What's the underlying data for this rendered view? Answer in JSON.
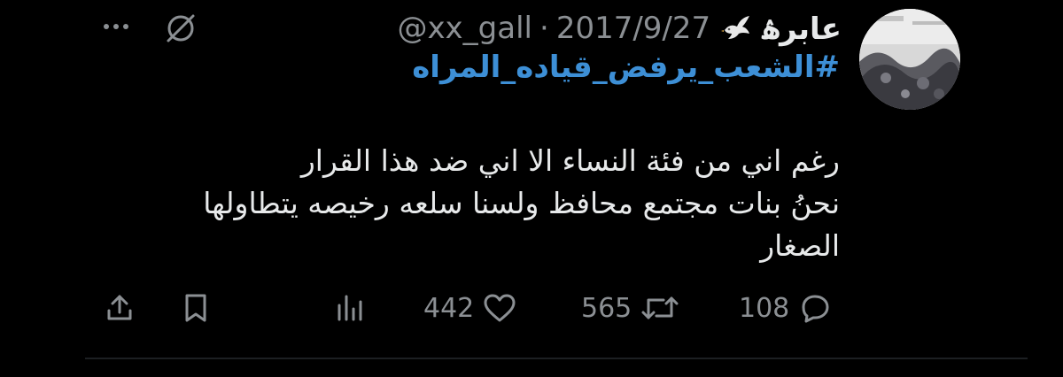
{
  "tweet": {
    "display_name": "عابرۿ",
    "handle": "@xx_gall",
    "separator": "·",
    "date": "2017/9/27",
    "hashtag": "#الشعب_يرفض_قياده_المراه",
    "body_lines": [
      "رغم اني من فئة النساء الا اني ضد هذا القرار",
      "نحنُ بنات مجتمع محافظ ولسنا سلعه رخيصه يتطاولها",
      "الصغار"
    ]
  },
  "actions": {
    "replies": "108",
    "retweets": "565",
    "likes": "442"
  },
  "colors": {
    "background": "#000000",
    "text": "#e7e9ea",
    "muted": "#8b8f93",
    "hashtag": "#3d8fd6"
  },
  "icons": [
    "avatar",
    "dove-icon",
    "grok-icon",
    "more-icon",
    "reply-icon",
    "retweet-icon",
    "like-icon",
    "views-icon",
    "bookmark-icon",
    "share-icon"
  ]
}
